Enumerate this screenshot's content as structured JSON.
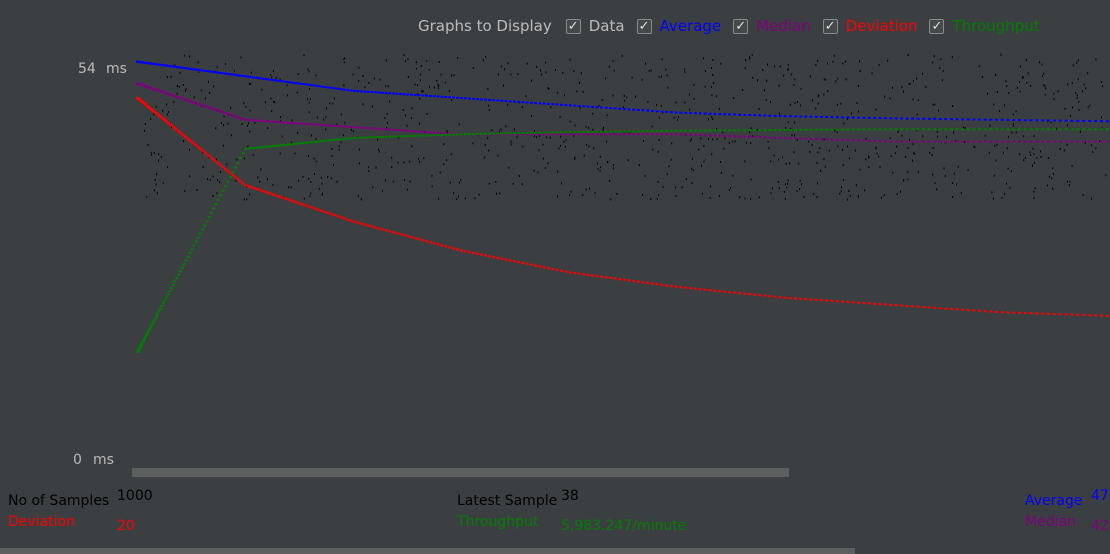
{
  "legend": {
    "title": "Graphs to Display",
    "items": [
      {
        "key": "data",
        "label": "Data",
        "color": "#000000",
        "checked": true
      },
      {
        "key": "average",
        "label": "Average",
        "color": "#0000ff",
        "checked": true
      },
      {
        "key": "median",
        "label": "Median",
        "color": "#800080",
        "checked": true
      },
      {
        "key": "deviation",
        "label": "Deviation",
        "color": "#ff0000",
        "checked": true
      },
      {
        "key": "throughput",
        "label": "Throughput",
        "color": "#008000",
        "checked": true
      }
    ]
  },
  "axis": {
    "ymax_label": "54",
    "ymin_label": "0",
    "unit": "ms"
  },
  "stats": {
    "samples_label": "No of Samples",
    "samples_value": "1000",
    "latest_label": "Latest Sample",
    "latest_value": "38",
    "average_label": "Average",
    "average_value": "47",
    "deviation_label": "Deviation",
    "deviation_value": "20",
    "throughput_label": "Throughput",
    "throughput_value": "5,983.247/minute",
    "median_label": "Median",
    "median_value": "42"
  },
  "chart_data": {
    "type": "scatter",
    "ylim": [
      0,
      54
    ],
    "series": [
      {
        "name": "Average",
        "values": [
          55,
          53,
          51,
          50,
          49,
          48,
          47.5,
          47.2,
          47,
          46.8
        ]
      },
      {
        "name": "Median",
        "values": [
          52,
          47,
          46,
          45,
          45,
          45,
          44.5,
          44,
          44,
          44
        ]
      },
      {
        "name": "Deviation",
        "values": [
          50,
          38,
          33,
          29,
          26,
          24,
          22.5,
          21.5,
          20.5,
          20
        ]
      },
      {
        "name": "Throughput",
        "values": [
          15,
          43,
          44.5,
          45,
          45.3,
          45.5,
          45.6,
          45.7,
          45.7,
          45.7
        ]
      }
    ]
  }
}
